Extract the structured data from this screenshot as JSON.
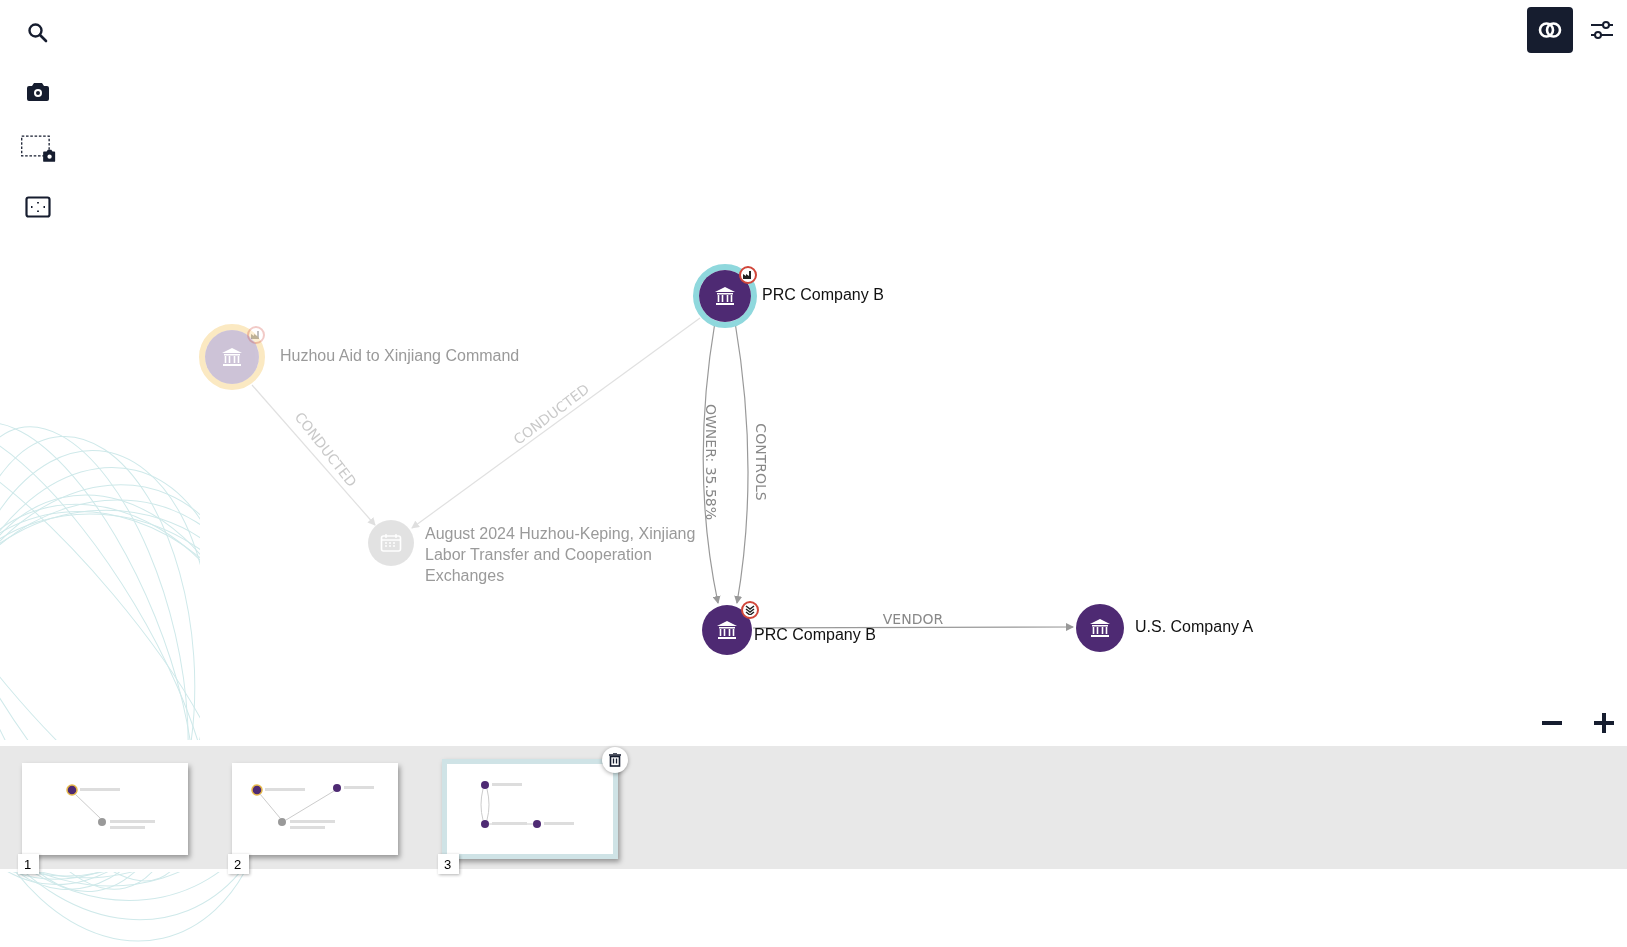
{
  "graph": {
    "nodes": [
      {
        "kind": "organization",
        "label": "Huzhou Aid to Xinjiang Command",
        "dimmed": true,
        "color": "#fbe9c2",
        "flagged": true
      },
      {
        "kind": "event",
        "label": "August 2024 Huzhou-Keping, Xinjiang Labor Transfer and Cooperation Exchanges",
        "dimmed": true
      },
      {
        "kind": "organization",
        "label": "PRC Company B",
        "dimmed": false,
        "color": "#8fd8dd",
        "flagged": true
      },
      {
        "kind": "organization",
        "label": "PRC Company B",
        "dimmed": false,
        "flagged": true
      },
      {
        "kind": "organization",
        "label": "U.S. Company A",
        "dimmed": false
      }
    ],
    "edges": [
      {
        "label": "CONDUCTED",
        "dimmed": true
      },
      {
        "label": "CONDUCTED",
        "dimmed": true
      },
      {
        "label": "OWNER: 35.58%",
        "dimmed": false
      },
      {
        "label": "CONTROLS",
        "dimmed": false
      },
      {
        "label": "VENDOR",
        "dimmed": false
      }
    ]
  },
  "snapshots": [
    {
      "number": "1",
      "selected": false
    },
    {
      "number": "2",
      "selected": false
    },
    {
      "number": "3",
      "selected": true
    }
  ]
}
